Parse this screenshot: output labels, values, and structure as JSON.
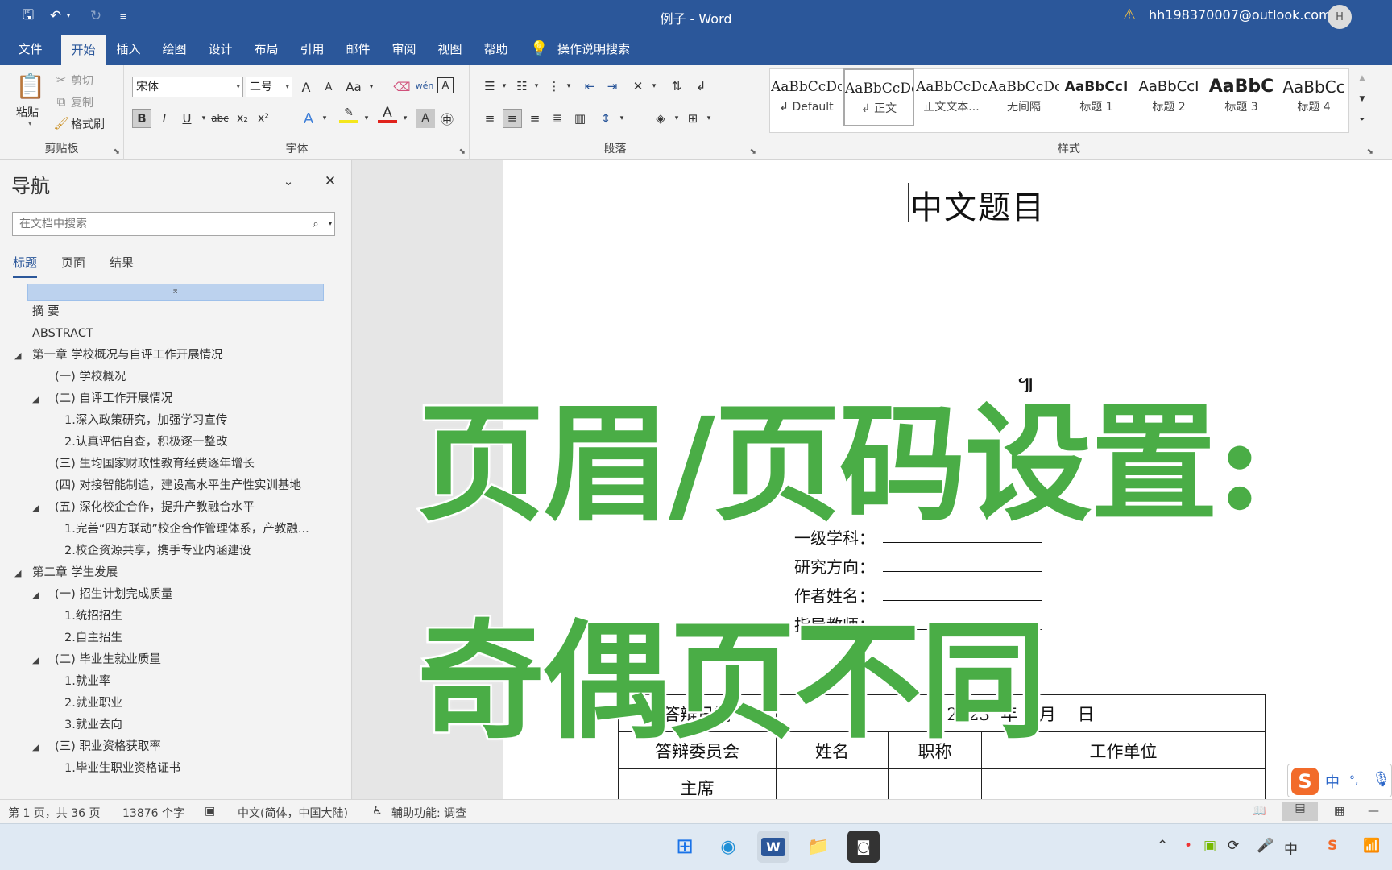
{
  "window": {
    "title": "例子 - Word",
    "account": "hh198370007@outlook.com",
    "avatar": "H"
  },
  "tabs": [
    "文件",
    "开始",
    "插入",
    "绘图",
    "设计",
    "布局",
    "引用",
    "邮件",
    "审阅",
    "视图",
    "帮助"
  ],
  "tellme": "操作说明搜索",
  "clipboard": {
    "paste": "粘贴",
    "cut": "剪切",
    "copy": "复制",
    "format_painter": "格式刷",
    "label": "剪贴板"
  },
  "font": {
    "name": "宋体",
    "size": "二号",
    "label": "字体",
    "case": "Aa",
    "grow": "A",
    "shrink": "A",
    "bold": "B",
    "italic": "I",
    "underline": "U",
    "strike": "abc",
    "sub": "x₂",
    "sup": "x²",
    "pinyin": "wén",
    "border": "A",
    "color": "A",
    "shade": "A"
  },
  "paragraph": {
    "label": "段落"
  },
  "styles": {
    "label": "样式",
    "items": [
      {
        "preview": "AaBbCcDc",
        "name": "↲ Default"
      },
      {
        "preview": "AaBbCcDc",
        "name": "↲ 正文"
      },
      {
        "preview": "AaBbCcDdI",
        "name": "正文文本..."
      },
      {
        "preview": "AaBbCcDc",
        "name": "无间隔"
      },
      {
        "preview": "AaBbCcI",
        "name": "标题 1"
      },
      {
        "preview": "AaBbCcI",
        "name": "标题 2"
      },
      {
        "preview": "AaBbC",
        "name": "标题 3"
      },
      {
        "preview": "AaBbCc",
        "name": "标题 4"
      }
    ]
  },
  "nav": {
    "title": "导航",
    "search_placeholder": "在文档中搜索",
    "tabs": [
      "标题",
      "页面",
      "结果"
    ],
    "items": [
      {
        "text": "摘 要",
        "level": 0,
        "expand": ""
      },
      {
        "text": "ABSTRACT",
        "level": 0,
        "expand": ""
      },
      {
        "text": "第一章 学校概况与自评工作开展情况",
        "level": 0,
        "expand": "◢"
      },
      {
        "text": "(一) 学校概况",
        "level": 1,
        "expand": ""
      },
      {
        "text": "(二) 自评工作开展情况",
        "level": 1,
        "expand": "◢"
      },
      {
        "text": "1.深入政策研究，加强学习宣传",
        "level": 2,
        "expand": ""
      },
      {
        "text": "2.认真评估自查，积极逐一整改",
        "level": 2,
        "expand": ""
      },
      {
        "text": "(三) 生均国家财政性教育经费逐年增长",
        "level": 1,
        "expand": ""
      },
      {
        "text": "(四) 对接智能制造，建设高水平生产性实训基地",
        "level": 1,
        "expand": ""
      },
      {
        "text": "(五) 深化校企合作，提升产教融合水平",
        "level": 1,
        "expand": "◢"
      },
      {
        "text": "1.完善“四方联动”校企合作管理体系，产教融...",
        "level": 2,
        "expand": ""
      },
      {
        "text": "2.校企资源共享，携手专业内涵建设",
        "level": 2,
        "expand": ""
      },
      {
        "text": "第二章 学生发展",
        "level": 0,
        "expand": "◢"
      },
      {
        "text": "(一) 招生计划完成质量",
        "level": 1,
        "expand": "◢"
      },
      {
        "text": "1.统招招生",
        "level": 2,
        "expand": ""
      },
      {
        "text": "2.自主招生",
        "level": 2,
        "expand": ""
      },
      {
        "text": "(二) 毕业生就业质量",
        "level": 1,
        "expand": "◢"
      },
      {
        "text": "1.就业率",
        "level": 2,
        "expand": ""
      },
      {
        "text": "2.就业职业",
        "level": 2,
        "expand": ""
      },
      {
        "text": "3.就业去向",
        "level": 2,
        "expand": ""
      },
      {
        "text": "(三) 职业资格获取率",
        "level": 1,
        "expand": "◢"
      },
      {
        "text": "1.毕业生职业资格证书",
        "level": 2,
        "expand": ""
      }
    ]
  },
  "doc": {
    "title": "中文题目",
    "mark": "៕",
    "fields": [
      "一级学科：",
      "研究方向：",
      "作者姓名：",
      "指导教师："
    ],
    "table": [
      [
        "答辩日期",
        "2023  年    月    日"
      ],
      [
        "答辩委员会",
        "姓名",
        "职称",
        "工作单位"
      ],
      [
        "主席",
        "",
        "",
        ""
      ]
    ]
  },
  "overlay": {
    "line1": "页眉/页码设置:",
    "line2": "奇偶页不同"
  },
  "ime": {
    "lang": "中",
    "punct": "°,"
  },
  "status": {
    "page": "第 1 页，共 36 页",
    "words": "13876 个字",
    "lang": "中文(简体，中国大陆)",
    "a11y": "辅助功能: 调查"
  },
  "tray": {
    "ime": "中"
  },
  "colors": {
    "brand": "#2b579a",
    "overlay_green": "#4aad46"
  }
}
